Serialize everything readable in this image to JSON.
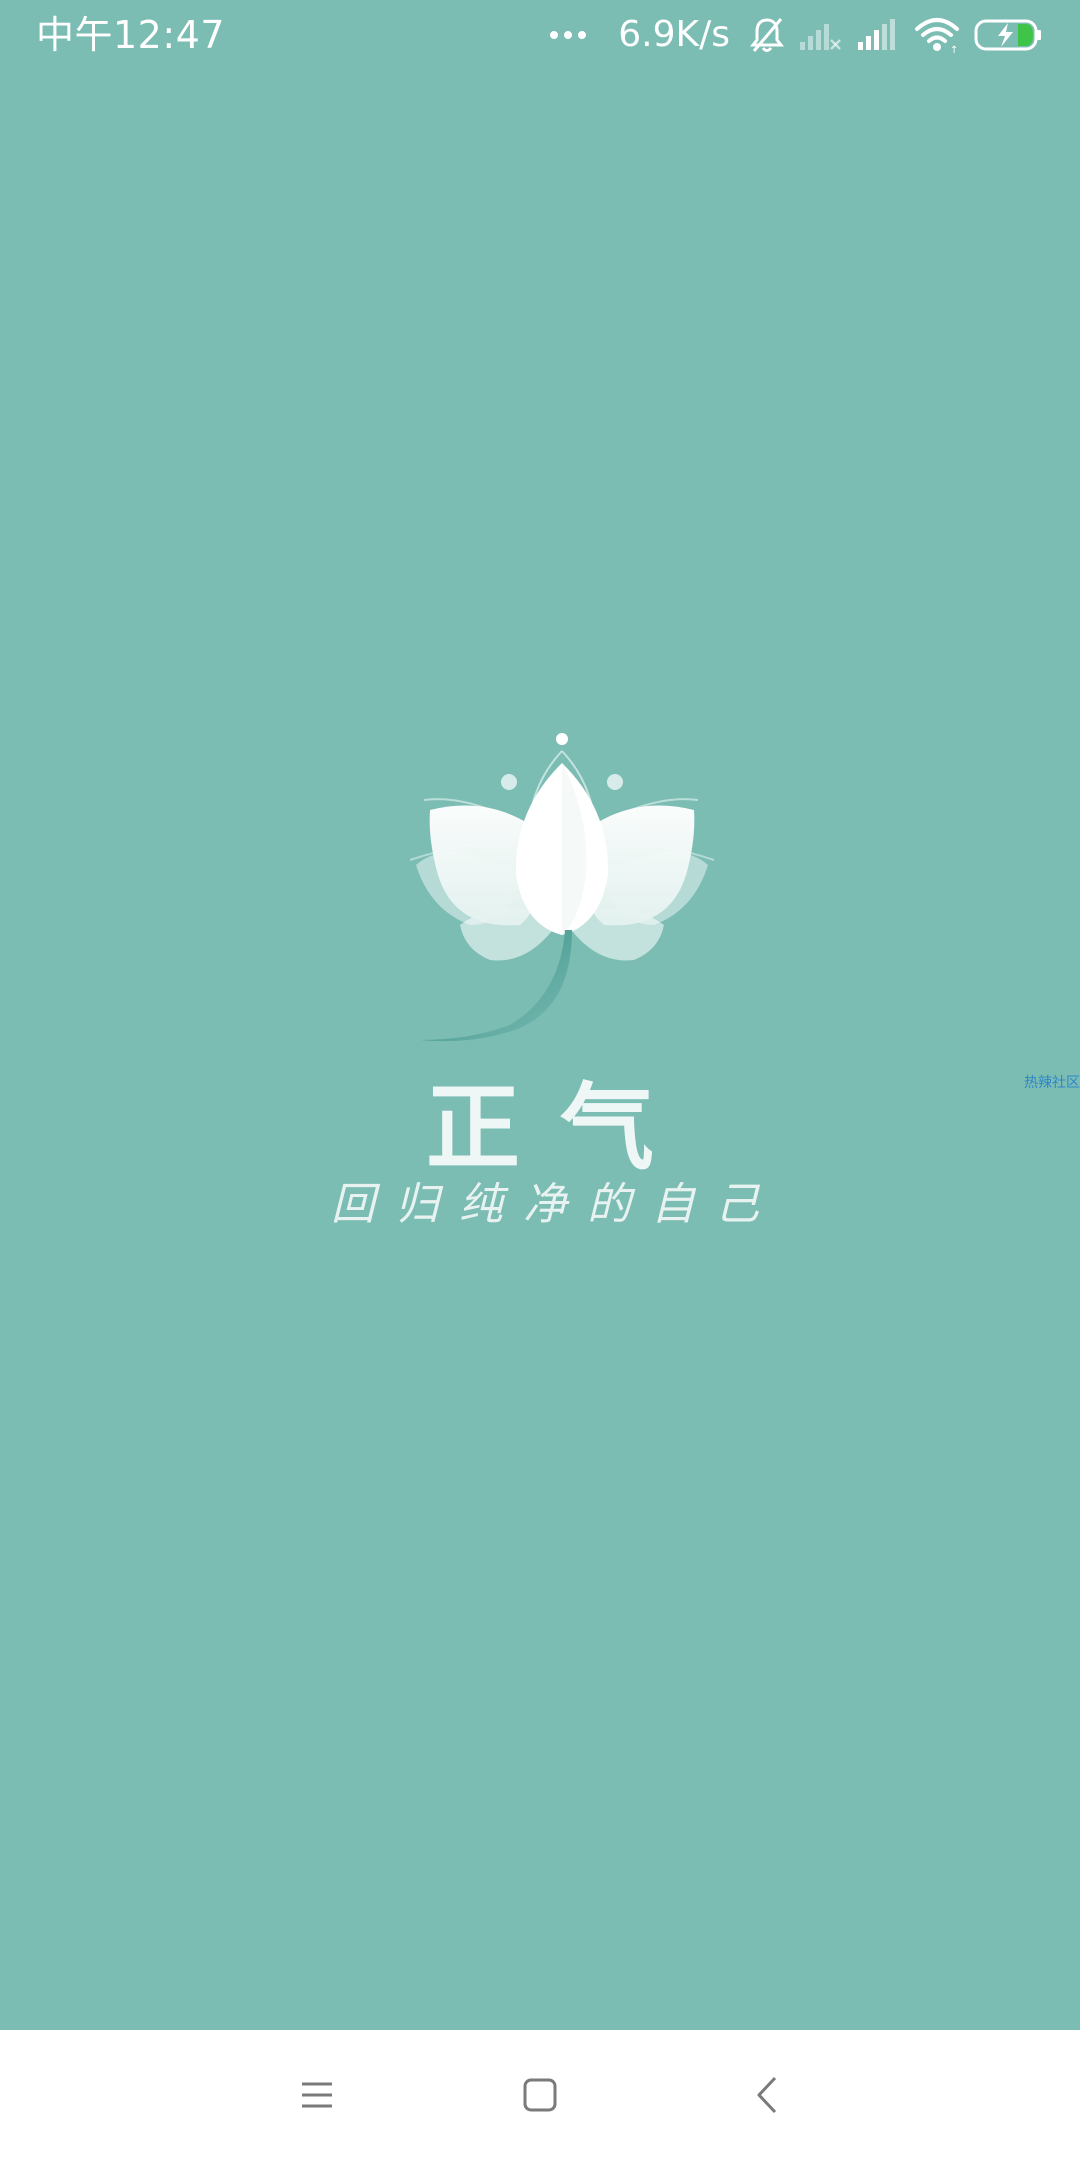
{
  "status_bar": {
    "time": "中午12:47",
    "net_speed": "6.9K/s",
    "icons": [
      "more-dots-icon",
      "mute-bell-icon",
      "no-signal-icon",
      "signal-icon",
      "wifi-icon",
      "battery-charging-icon"
    ]
  },
  "splash": {
    "logo": "lotus-logo-icon",
    "app_name": "正气",
    "slogan": "回归纯净的自己",
    "side_badge": "热辣社区"
  },
  "nav_bar": {
    "buttons": [
      "menu-icon",
      "home-icon",
      "back-icon"
    ]
  },
  "colors": {
    "background": "#7bbcb3",
    "nav_background": "#ffffff",
    "accent": "#2f8a82"
  }
}
